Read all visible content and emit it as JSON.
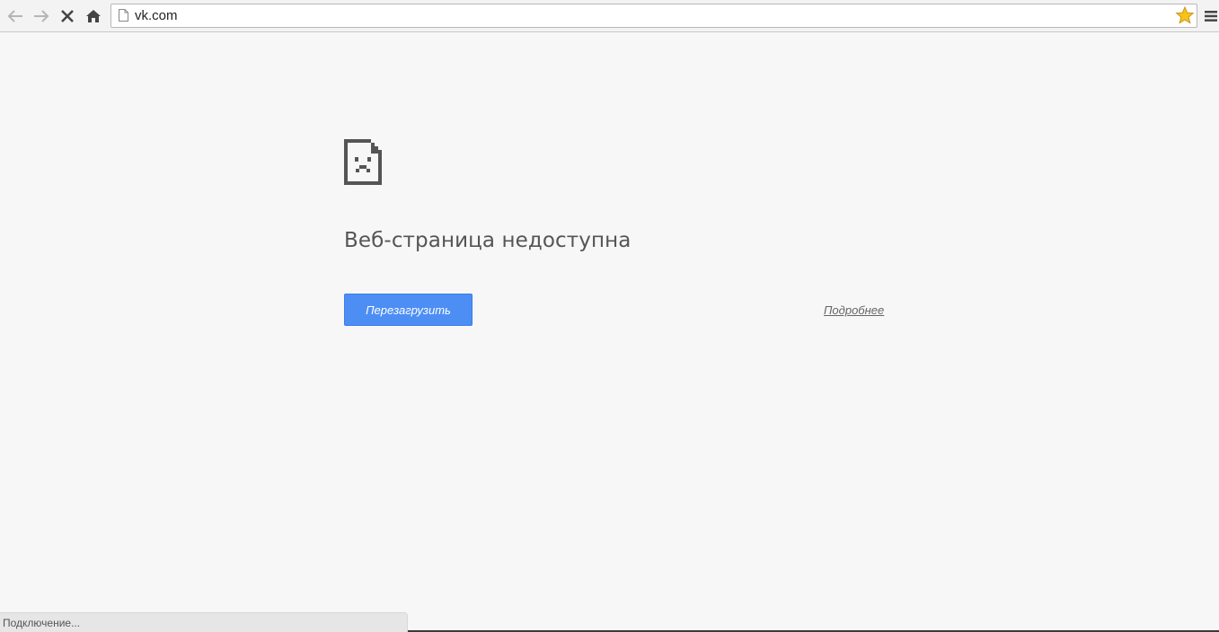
{
  "toolbar": {
    "url": "vk.com",
    "icons": [
      "back-arrow-icon",
      "forward-arrow-icon",
      "stop-icon",
      "home-icon",
      "page-icon",
      "star-icon",
      "menu-icon"
    ],
    "star_color": "#f7c21a"
  },
  "error": {
    "icon": "sad-page-icon",
    "title": "Веб-страница недоступна",
    "reload_label": "Перезагрузить",
    "details_label": "Подробнее",
    "button_color": "#4d8ef5"
  },
  "status": {
    "text": "Подключение..."
  }
}
